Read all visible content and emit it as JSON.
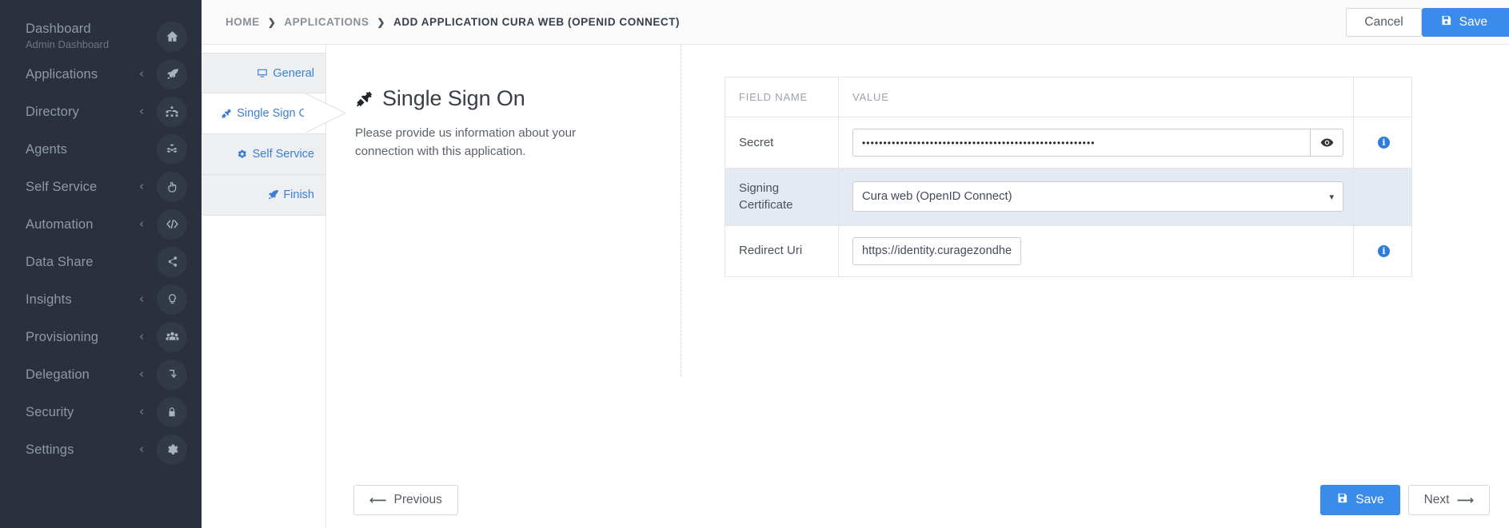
{
  "sidebar": {
    "items": [
      {
        "label": "Dashboard",
        "sublabel": "Admin Dashboard",
        "icon": "home-icon",
        "chevron": ""
      },
      {
        "label": "Applications",
        "sublabel": "",
        "icon": "rocket-icon",
        "chevron": "‹"
      },
      {
        "label": "Directory",
        "sublabel": "",
        "icon": "sitemap-icon",
        "chevron": "‹"
      },
      {
        "label": "Agents",
        "sublabel": "",
        "icon": "cubes-icon",
        "chevron": ""
      },
      {
        "label": "Self Service",
        "sublabel": "",
        "icon": "hand-pointer-icon",
        "chevron": "‹"
      },
      {
        "label": "Automation",
        "sublabel": "",
        "icon": "code-icon",
        "chevron": "‹"
      },
      {
        "label": "Data Share",
        "sublabel": "",
        "icon": "share-icon",
        "chevron": ""
      },
      {
        "label": "Insights",
        "sublabel": "",
        "icon": "lightbulb-icon",
        "chevron": "‹"
      },
      {
        "label": "Provisioning",
        "sublabel": "",
        "icon": "users-icon",
        "chevron": "‹"
      },
      {
        "label": "Delegation",
        "sublabel": "",
        "icon": "arrow-turn-down-icon",
        "chevron": "‹"
      },
      {
        "label": "Security",
        "sublabel": "",
        "icon": "lock-icon",
        "chevron": "‹"
      },
      {
        "label": "Settings",
        "sublabel": "",
        "icon": "gear-icon",
        "chevron": "‹"
      }
    ]
  },
  "topbar": {
    "breadcrumb": [
      {
        "label": "HOME"
      },
      {
        "label": "APPLICATIONS"
      },
      {
        "label": "ADD APPLICATION CURA WEB (OPENID CONNECT)"
      }
    ],
    "separator": "❯",
    "cancel_label": "Cancel",
    "save_label": "Save"
  },
  "wizard": {
    "steps": [
      {
        "label": "General",
        "icon": "desktop-icon",
        "active": false
      },
      {
        "label": "Single Sign On",
        "icon": "plug-icon",
        "active": true
      },
      {
        "label": "Self Service",
        "icon": "cogs-icon",
        "active": false
      },
      {
        "label": "Finish",
        "icon": "rocket-icon",
        "active": false
      }
    ]
  },
  "section": {
    "title": "Single Sign On",
    "title_icon": "plug-icon",
    "description": "Please provide us information about your connection with this application."
  },
  "table": {
    "headers": [
      "FIELD NAME",
      "VALUE",
      ""
    ],
    "rows": [
      {
        "name": "Secret",
        "type": "password",
        "value": "•••••••••••••••••••••••••••••••••••••••••••••••••••••••",
        "reveal_icon": "eye-icon",
        "info": "i",
        "highlighted": false
      },
      {
        "name": "Signing Certificate",
        "type": "select",
        "value": "Cura web (OpenID Connect)",
        "caret": "▾",
        "info": "",
        "highlighted": true
      },
      {
        "name": "Redirect Uri",
        "type": "text",
        "value": "https://identity.curagezondheidszorg.nl/auth/realms/enyoi/broker/oidc/endpoint",
        "info": "i",
        "highlighted": false
      }
    ]
  },
  "footer": {
    "previous_label": "Previous",
    "previous_icon": "arrow-left-icon",
    "save_label": "Save",
    "save_icon": "floppy-disk-icon",
    "next_label": "Next",
    "next_icon": "arrow-right-icon"
  },
  "colors": {
    "sidebar_bg": "#2b313c",
    "accent_blue": "#3b8bea",
    "link_blue": "#3b7fd4",
    "row_highlight": "#e3eaf4",
    "info_blue": "#2f7ddb"
  }
}
